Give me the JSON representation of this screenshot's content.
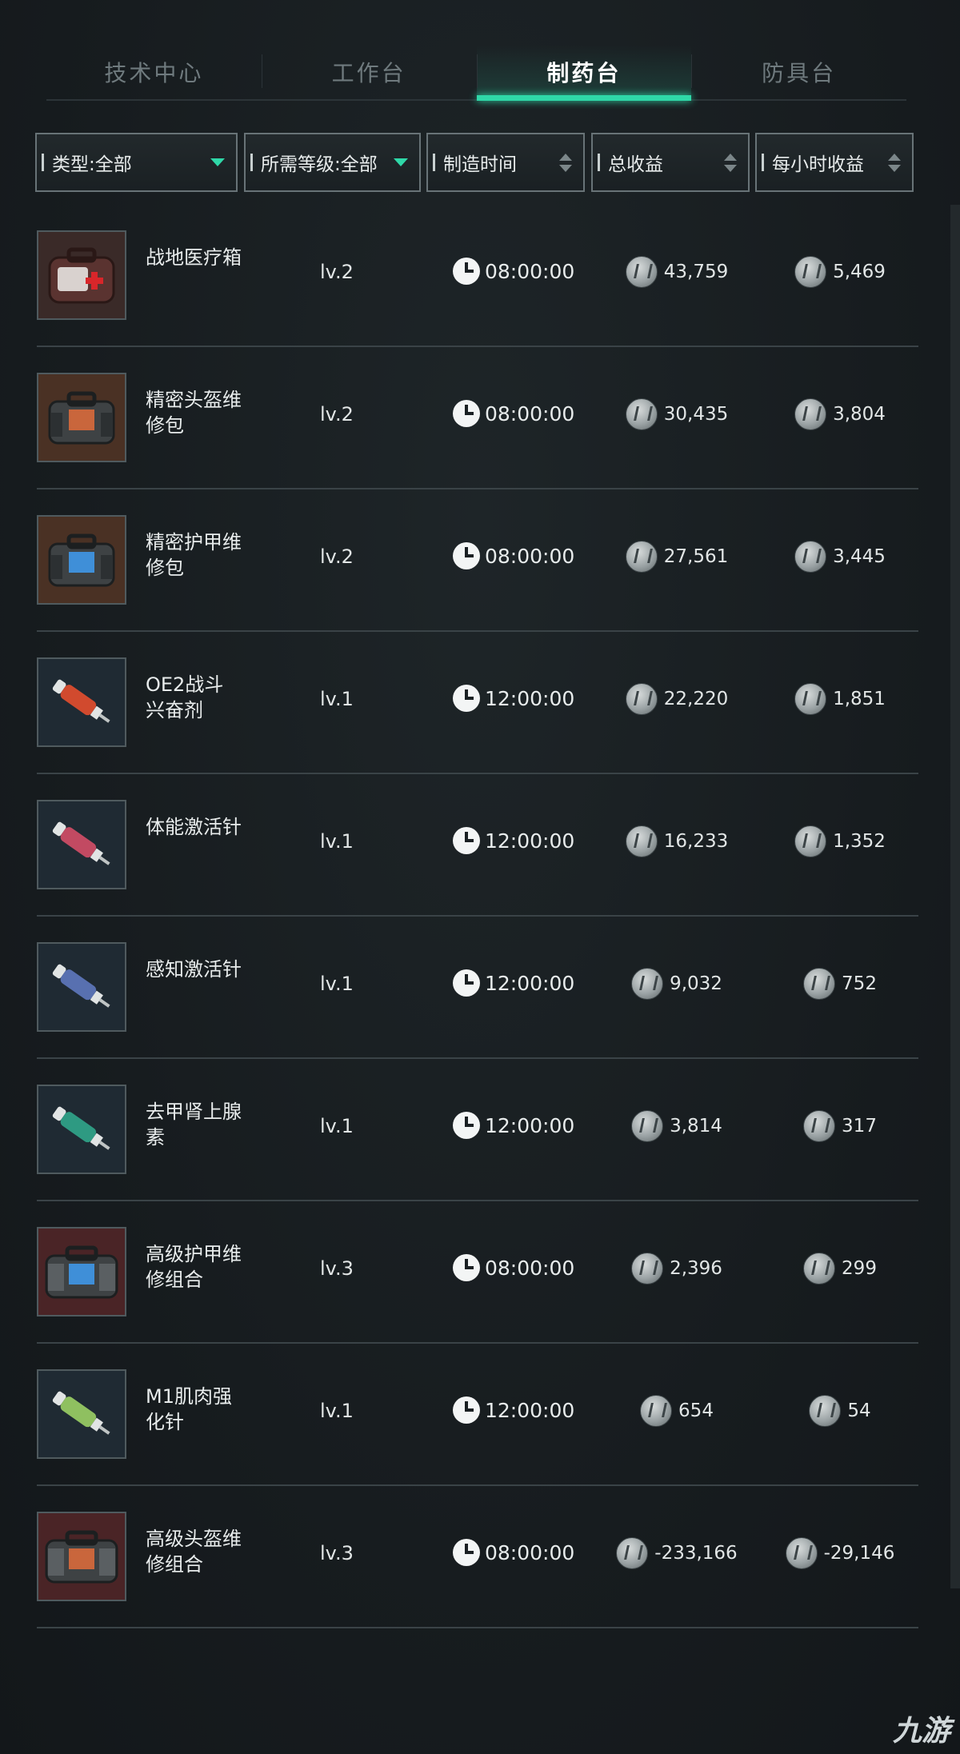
{
  "tabs": [
    {
      "label": "技术中心",
      "active": false
    },
    {
      "label": "工作台",
      "active": false
    },
    {
      "label": "制药台",
      "active": true
    },
    {
      "label": "防具台",
      "active": false
    }
  ],
  "filters": {
    "type": "类型:全部",
    "level": "所需等级:全部",
    "time": "制造时间",
    "total": "总收益",
    "hourly": "每小时收益"
  },
  "colors": {
    "accent": "#2fd8a8",
    "background": "#171c1f"
  },
  "items": [
    {
      "name": "战地医疗箱",
      "level": "lv.2",
      "time": "08:00:00",
      "total": "43,759",
      "hourly": "5,469",
      "icon": "medkit-red"
    },
    {
      "name": "精密头盔维修包",
      "level": "lv.2",
      "time": "08:00:00",
      "total": "30,435",
      "hourly": "3,804",
      "icon": "repair-bag-orange"
    },
    {
      "name": "精密护甲维修包",
      "level": "lv.2",
      "time": "08:00:00",
      "total": "27,561",
      "hourly": "3,445",
      "icon": "repair-bag-blue"
    },
    {
      "name": "OE2战斗兴奋剂",
      "level": "lv.1",
      "time": "12:00:00",
      "total": "22,220",
      "hourly": "1,851",
      "icon": "syringe-orange"
    },
    {
      "name": "体能激活针",
      "level": "lv.1",
      "time": "12:00:00",
      "total": "16,233",
      "hourly": "1,352",
      "icon": "syringe-pink"
    },
    {
      "name": "感知激活针",
      "level": "lv.1",
      "time": "12:00:00",
      "total": "9,032",
      "hourly": "752",
      "icon": "syringe-blue"
    },
    {
      "name": "去甲肾上腺素",
      "level": "lv.1",
      "time": "12:00:00",
      "total": "3,814",
      "hourly": "317",
      "icon": "syringe-teal"
    },
    {
      "name": "高级护甲维修组合",
      "level": "lv.3",
      "time": "08:00:00",
      "total": "2,396",
      "hourly": "299",
      "icon": "repair-kit-blue"
    },
    {
      "name": "M1肌肉强化针",
      "level": "lv.1",
      "time": "12:00:00",
      "total": "654",
      "hourly": "54",
      "icon": "syringe-green"
    },
    {
      "name": "高级头盔维修组合",
      "level": "lv.3",
      "time": "08:00:00",
      "total": "-233,166",
      "hourly": "-29,146",
      "icon": "repair-kit-red"
    }
  ],
  "watermark": "九游"
}
